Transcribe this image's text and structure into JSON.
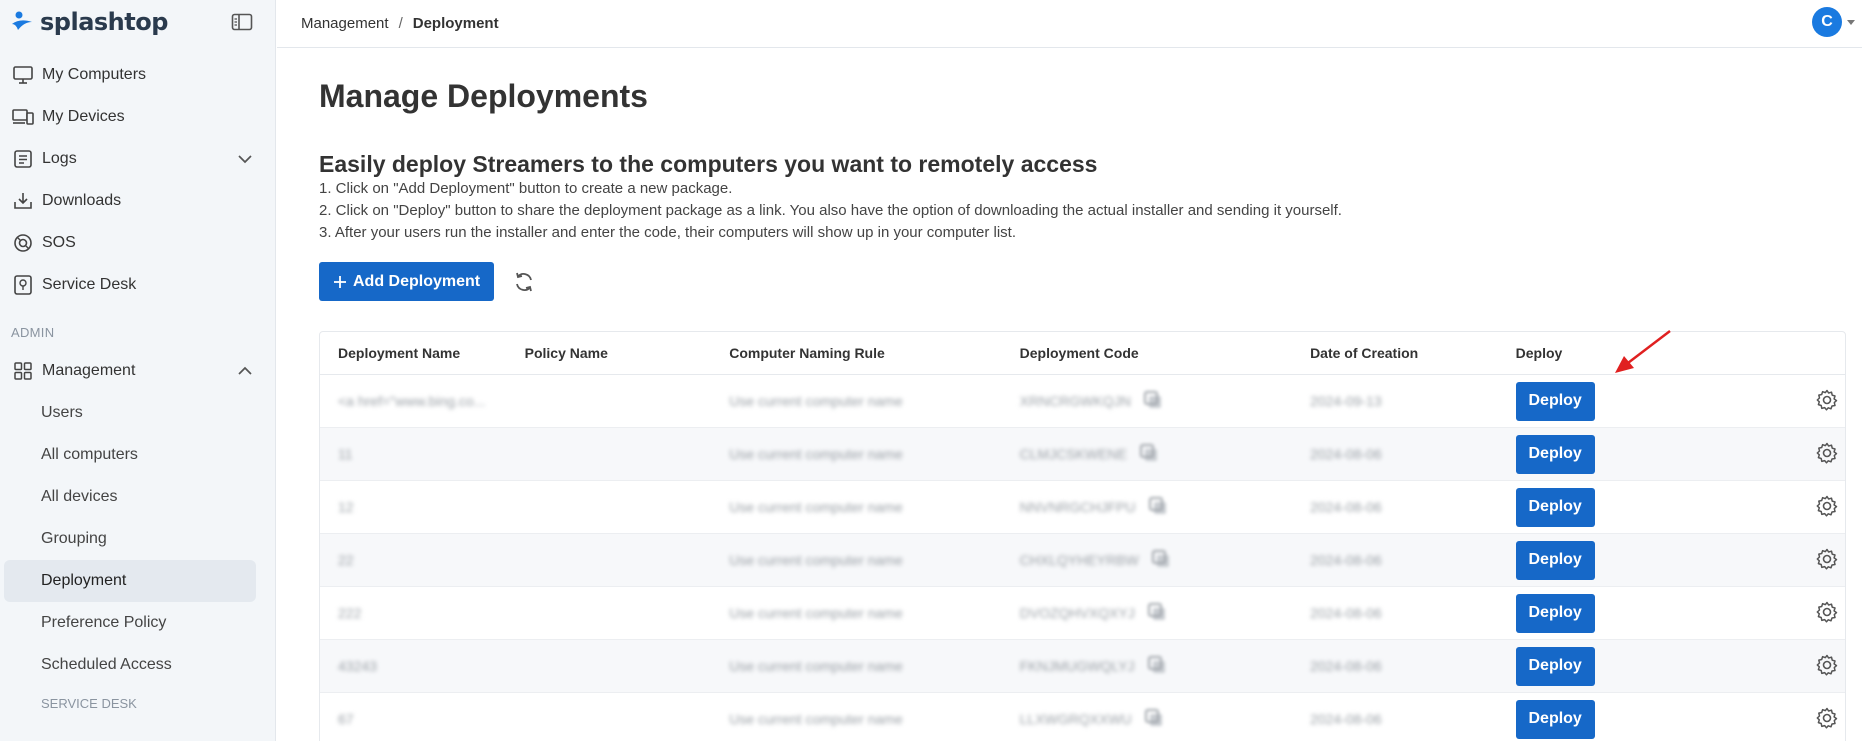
{
  "brand": {
    "name": "splashtop"
  },
  "sidebar": {
    "items": [
      {
        "label": "My Computers",
        "icon": "monitor-icon"
      },
      {
        "label": "My Devices",
        "icon": "devices-icon"
      },
      {
        "label": "Logs",
        "icon": "logs-icon"
      },
      {
        "label": "Downloads",
        "icon": "download-icon"
      },
      {
        "label": "SOS",
        "icon": "sos-icon"
      },
      {
        "label": "Service Desk",
        "icon": "service-desk-icon"
      }
    ],
    "admin_label": "ADMIN",
    "management": {
      "label": "Management",
      "subitems": [
        "Users",
        "All computers",
        "All devices",
        "Grouping",
        "Deployment",
        "Preference Policy",
        "Scheduled Access"
      ]
    },
    "service_desk_label": "SERVICE DESK"
  },
  "breadcrumb": {
    "parent": "Management",
    "sep": "/",
    "current": "Deployment"
  },
  "user": {
    "initial": "C"
  },
  "page": {
    "title": "Manage Deployments",
    "subtitle": "Easily deploy Streamers to the computers you want to remotely access",
    "instructions": [
      "1. Click on \"Add Deployment\" button to create a new package.",
      "2. Click on \"Deploy\" button to share the deployment package as a link. You also have the option of downloading the actual installer and sending it yourself.",
      "3. After your users run the installer and enter the code, their computers will show up in your computer list."
    ],
    "add_button": "Add Deployment"
  },
  "table": {
    "headers": [
      "Deployment Name",
      "Policy Name",
      "Computer Naming Rule",
      "Deployment Code",
      "Date of Creation",
      "Deploy"
    ],
    "deploy_label": "Deploy",
    "rows": [
      {
        "name": "<a href=\"www.bing.co...",
        "policy": "",
        "rule": "Use current computer name",
        "code": "XRNCRGWKQJN",
        "date": "2024-09-13"
      },
      {
        "name": "11",
        "policy": "",
        "rule": "Use current computer name",
        "code": "CLMJCSKWENE",
        "date": "2024-08-06"
      },
      {
        "name": "12",
        "policy": "",
        "rule": "Use current computer name",
        "code": "NNVNRGCHJFPU",
        "date": "2024-08-06"
      },
      {
        "name": "22",
        "policy": "",
        "rule": "Use current computer name",
        "code": "CHXLQYHEYRBW",
        "date": "2024-08-06"
      },
      {
        "name": "222",
        "policy": "",
        "rule": "Use current computer name",
        "code": "DVOZQHVXQXYJ",
        "date": "2024-08-06"
      },
      {
        "name": "43243",
        "policy": "",
        "rule": "Use current computer name",
        "code": "FKNJMUGWQLYJ",
        "date": "2024-08-06"
      },
      {
        "name": "67",
        "policy": "",
        "rule": "Use current computer name",
        "code": "LLXWGRQXXWU",
        "date": "2024-08-06"
      }
    ]
  },
  "colors": {
    "primary": "#1668c8",
    "avatar": "#1a7ae0",
    "arrow": "#e02020"
  }
}
